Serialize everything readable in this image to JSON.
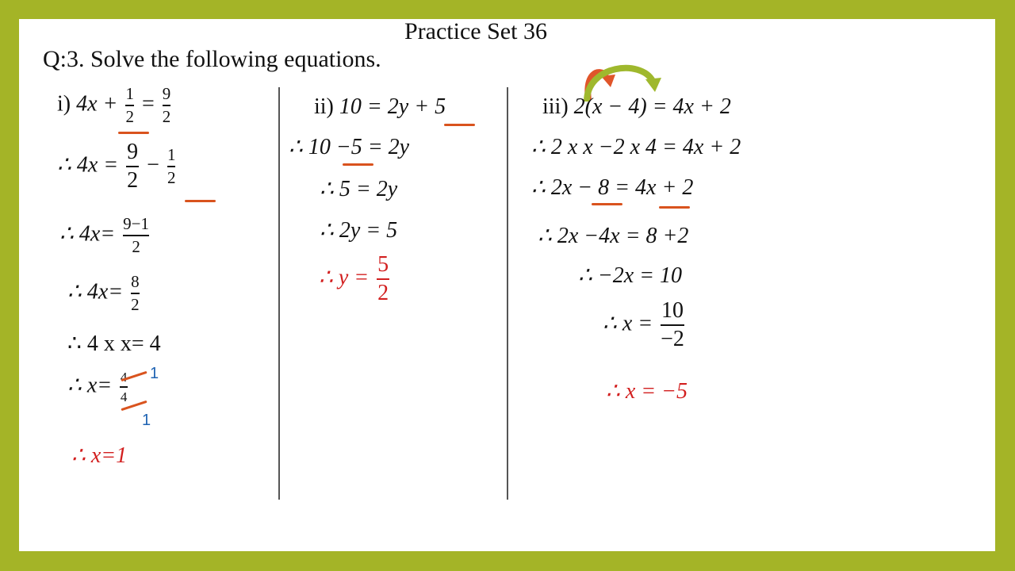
{
  "header": {
    "title": "Practice Set 36",
    "question": "Q:3. Solve the following equations."
  },
  "colors": {
    "border": "#a4b427",
    "answer": "#d21f1f",
    "highlight": "#d9531e",
    "cancel_note": "#1f63b3"
  },
  "part1": {
    "label": "i)",
    "step1": {
      "lhs": "4x +",
      "frac_num": "1",
      "frac_den": "2",
      "eq": "=",
      "rhs_num": "9",
      "rhs_den": "2"
    },
    "step2": {
      "prefix": "∴ 4x =",
      "a_num": "9",
      "a_den": "2",
      "op": "−",
      "b_num": "1",
      "b_den": "2"
    },
    "step3": {
      "prefix": "∴ 4x=",
      "num": "9−1",
      "den": "2"
    },
    "step4": {
      "prefix": "∴ 4x=",
      "num": "8",
      "den": "2"
    },
    "step5": "∴ 4 x x= 4",
    "step6": {
      "prefix": "∴ x=",
      "num": "4",
      "den": "4",
      "num_cancel": "1",
      "den_cancel": "1"
    },
    "answer": "∴ x=1"
  },
  "part2": {
    "label": "ii)",
    "step1": "10 = 2y + 5",
    "step2": "∴ 10 −5 = 2y",
    "step3": "∴ 5 = 2y",
    "step4": "∴ 2y = 5",
    "answer": {
      "prefix": "∴  y =",
      "num": "5",
      "den": "2"
    }
  },
  "part3": {
    "label": "iii)",
    "step1": "2(x − 4) = 4x + 2",
    "step2": "∴ 2 x x  −2 x 4  = 4x + 2",
    "step3": "∴ 2x − 8 = 4x + 2",
    "step4": "∴ 2x −4x   = 8 +2",
    "step5": "∴ −2x = 10",
    "step6": {
      "prefix": "∴ x =",
      "num": "10",
      "den": "−2"
    },
    "answer": "∴ x = −5"
  }
}
